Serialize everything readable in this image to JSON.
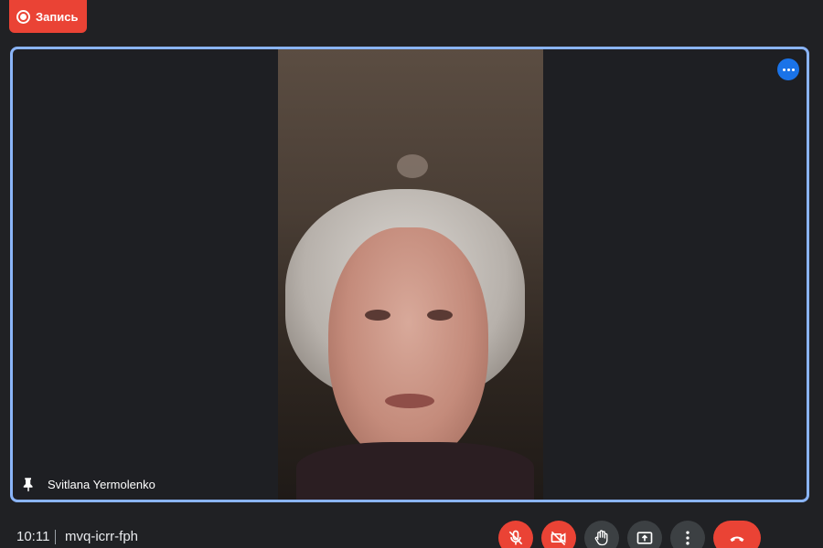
{
  "recording": {
    "label": "Запись"
  },
  "participant": {
    "name": "Svitlana Yermolenko"
  },
  "meeting": {
    "time": "10:11",
    "code": "mvq-icrr-fph"
  },
  "colors": {
    "accent": "#8ab4f8",
    "danger": "#ea4335",
    "control": "#3c4043",
    "menu": "#1a73e8"
  },
  "controls": [
    {
      "name": "mic-toggle",
      "icon": "mic-off-icon",
      "state": "off"
    },
    {
      "name": "camera-toggle",
      "icon": "camera-off-icon",
      "state": "off"
    },
    {
      "name": "raise-hand",
      "icon": "hand-icon"
    },
    {
      "name": "present",
      "icon": "present-screen-icon"
    },
    {
      "name": "more-options",
      "icon": "more-vert-icon"
    },
    {
      "name": "leave-call",
      "icon": "hangup-icon"
    }
  ]
}
